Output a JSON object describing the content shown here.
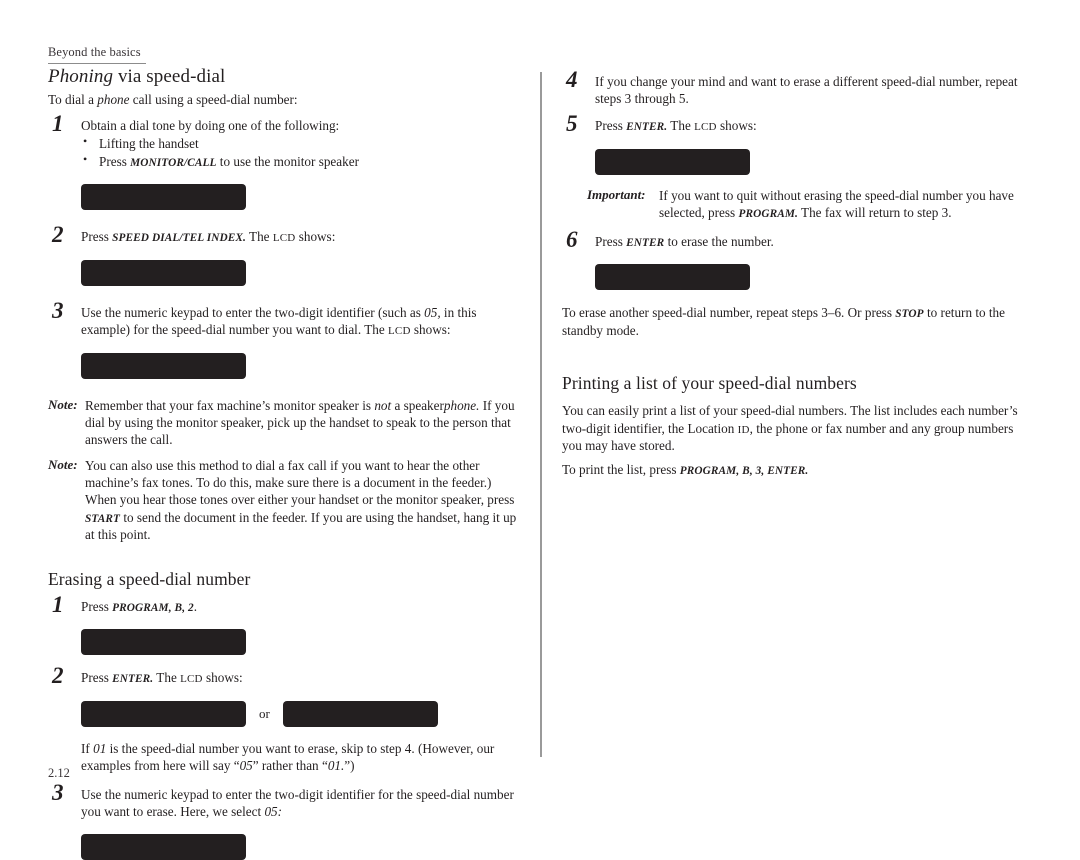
{
  "page": {
    "running_head": "Beyond the basics",
    "folio": "2.12",
    "ink_color": "#231f20",
    "rule_color": "#9a9a9a"
  },
  "left_column": {
    "section_heading": {
      "italic_part": "Phoning",
      "roman_part": " via speed-dial"
    },
    "lead_in": {
      "before": "To dial a ",
      "italic": "phone",
      "after": " call using a speed-dial number:"
    },
    "step1": {
      "number": "1",
      "text": "Obtain a dial tone by doing one of the following:",
      "bullet1": "Lifting the handset",
      "bullet2_before": "Press ",
      "bullet2_key": "MONITOR/CALL",
      "bullet2_after": " to use the monitor speaker",
      "lcd_label": "lcd-display-bar"
    },
    "step2": {
      "number": "2",
      "before": "Press ",
      "key": "SPEED DIAL/TEL INDEX.",
      "middle": " The ",
      "smallcaps": "LCD",
      "after": " shows:",
      "lcd_label": "lcd-display-bar"
    },
    "step3": {
      "number": "3",
      "line1_before": "Use the numeric keypad to enter the two-digit identifier (such as ",
      "line1_italic": "05,",
      "line1_after": " in this",
      "line2_before": "example) for the speed-dial number you want to dial. The ",
      "line2_smallcaps": "LCD",
      "line2_after": " shows:",
      "lcd_label": "lcd-display-bar"
    },
    "note1": {
      "label": "Note:",
      "part1": "Remember that your fax machine’s monitor speaker is ",
      "italic1": "not",
      "part2": " a speaker",
      "italic2": "phone.",
      "part3": " If you dial by using the monitor speaker, pick up the handset to speak to the person that answers the call."
    },
    "note2": {
      "label": "Note:",
      "part1": "You can also use this method to dial a fax call if you want to hear the other machine’s fax tones. To do this, make sure there is a document in the feeder.) When you hear those tones over either your handset or the monitor speaker, press ",
      "key": "START",
      "part2": " to send the document in the feeder. If you are using the handset, hang it up at this point."
    },
    "erasing_heading": "Erasing a speed-dial number",
    "erase_step1": {
      "number": "1",
      "before": "Press ",
      "key": "PROGRAM, B, 2",
      "after": ".",
      "lcd_label": "lcd-display-bar"
    },
    "erase_step2": {
      "number": "2",
      "before": "Press ",
      "key": "ENTER.",
      "middle": " The ",
      "smallcaps": "LCD",
      "after": " shows:",
      "lcd_label_a": "lcd-display-bar-option-a",
      "or_label": "or",
      "lcd_label_b": "lcd-display-bar-option-b",
      "followup_before": "If ",
      "followup_italic1": "01",
      "followup_mid": " is the speed-dial number you want to erase, skip to step 4. (However, our examples from here will say “",
      "followup_italic2": "05",
      "followup_mid2": "” rather than “",
      "followup_italic3": "01.",
      "followup_after": "”)"
    },
    "erase_step3": {
      "number": "3",
      "line1": "Use the numeric keypad to enter the two-digit identifier for the speed-dial",
      "line2_before": "number you want to erase. Here, we select ",
      "line2_italic": "05:",
      "lcd_label": "lcd-display-bar"
    }
  },
  "right_column": {
    "erase_step4": {
      "number": "4",
      "line1": "If you change your mind and want to erase a different speed-dial number,",
      "line2": "repeat steps 3 through 5."
    },
    "erase_step5": {
      "number": "5",
      "before": "Press ",
      "key": "ENTER.",
      "middle": " The ",
      "smallcaps": "LCD",
      "after": " shows:",
      "lcd_label": "lcd-display-bar"
    },
    "important": {
      "label": "Important:",
      "part1": "If you want to quit without erasing the speed-dial number you have selected, press ",
      "key": "PROGRAM.",
      "part2": " The fax will return to step 3."
    },
    "erase_step6": {
      "number": "6",
      "before": "Press ",
      "key": "ENTER",
      "after": " to erase the number.",
      "lcd_label": "lcd-display-bar"
    },
    "closing_para": {
      "part1": "To erase another speed-dial number, repeat steps 3–6. Or press ",
      "key": "STOP",
      "part2": " to return to the standby mode."
    },
    "printing_heading": "Printing a list of your speed-dial numbers",
    "printing_para": {
      "part1": "You can easily print a list of your speed-dial numbers. The list includes each number’s two-digit identifier, the Location ",
      "smallcaps": "ID",
      "part2": ", the phone or fax number and any group numbers you may have stored."
    },
    "printing_instruction": {
      "before": "To print the list, press ",
      "key": "PROGRAM, B, 3, ENTER."
    }
  }
}
